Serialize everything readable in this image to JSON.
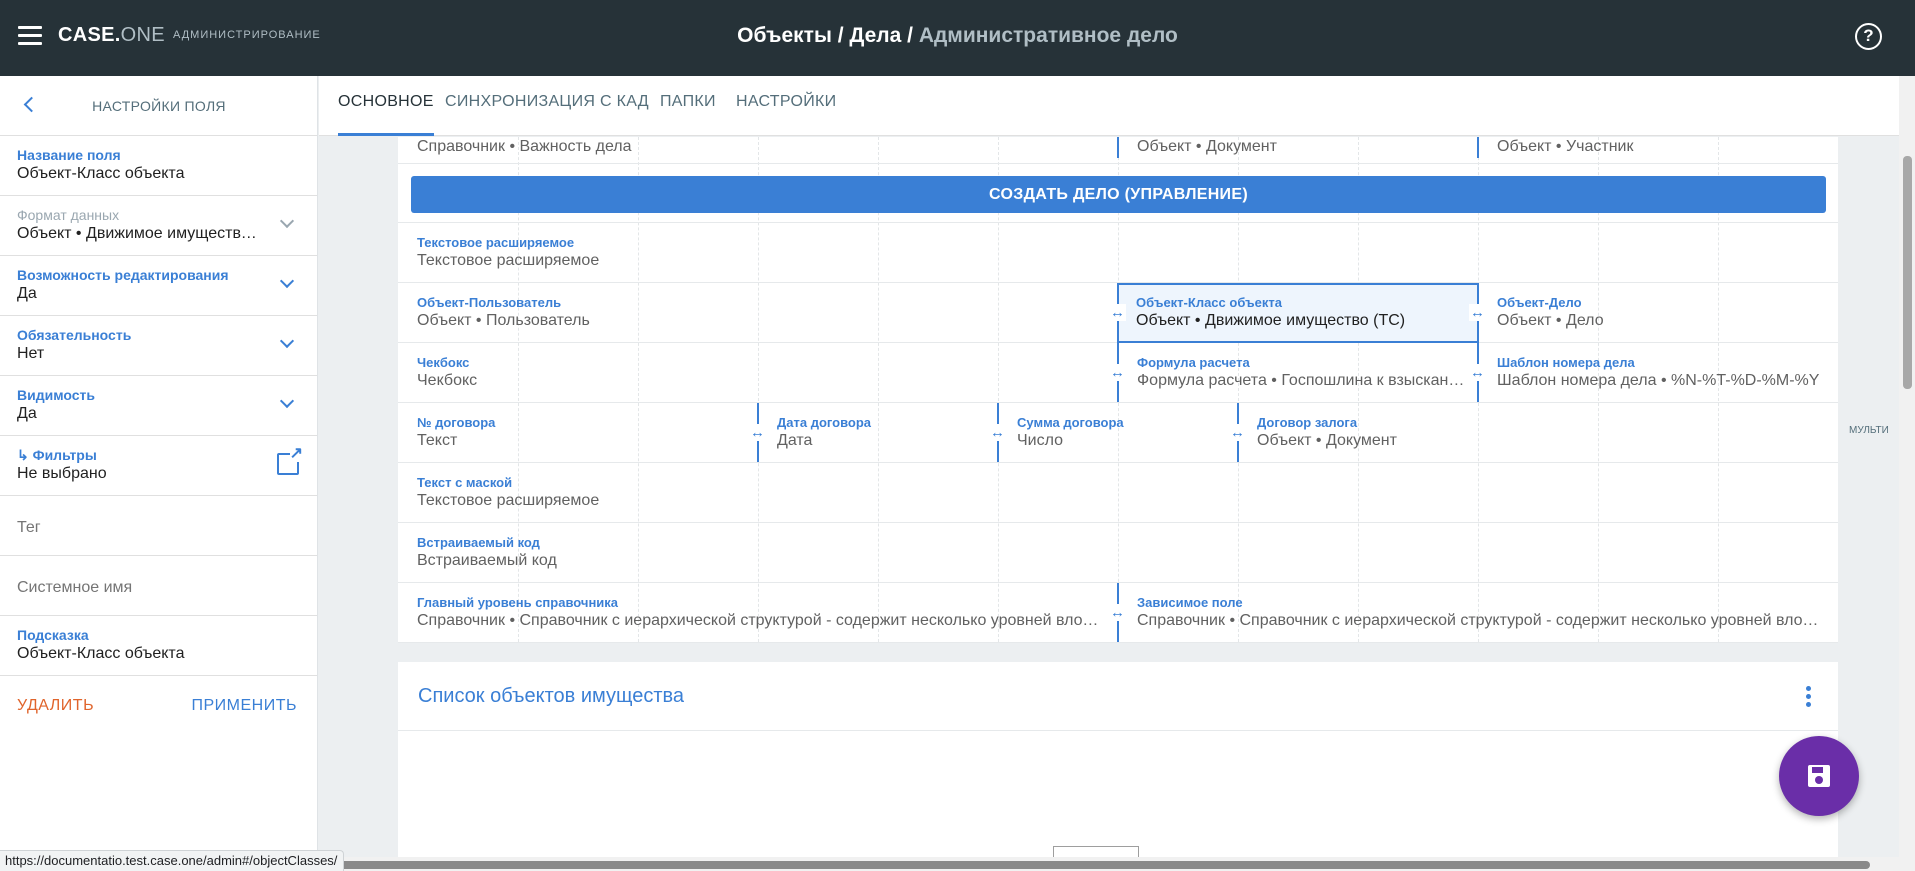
{
  "topbar": {
    "brand_main": "CASE.",
    "brand_accent": "ONE",
    "brand_sub": "АДМИНИСТРИРОВАНИЕ",
    "crumb_path": "Объекты / Дела / ",
    "crumb_current": "Административное дело",
    "help_symbol": "?"
  },
  "sidebar": {
    "title": "НАСТРОЙКИ ПОЛЯ",
    "fields": [
      {
        "label": "Название поля",
        "value": "Объект-Класс объекта"
      },
      {
        "label": "Формат данных",
        "value": "Объект • Движимое имущество (ТС)"
      },
      {
        "label": "Возможность редактирования",
        "value": "Да"
      },
      {
        "label": "Обязательность",
        "value": "Нет"
      },
      {
        "label": "Видимость",
        "value": "Да"
      },
      {
        "label": "Фильтры",
        "value": "Не выбрано"
      },
      {
        "placeholder": "Тег"
      },
      {
        "placeholder": "Системное имя"
      },
      {
        "label": "Подсказка",
        "value": "Объект-Класс объекта"
      }
    ],
    "delete_label": "УДАЛИТЬ",
    "apply_label": "ПРИМЕНИТЬ"
  },
  "tabs": [
    {
      "label": "ОСНОВНОЕ",
      "active": true
    },
    {
      "label": "СИНХРОНИЗАЦИЯ С КАД"
    },
    {
      "label": "ПАПКИ"
    },
    {
      "label": "НАСТРОЙКИ"
    }
  ],
  "layout_grid": {
    "row_top": [
      {
        "value": "Справочник • Важность дела"
      },
      {
        "value": "Объект • Документ"
      },
      {
        "value": "Объект • Участник"
      }
    ],
    "create_button": "СОЗДАТЬ ДЕЛО (УПРАВЛЕНИЕ)",
    "row_text_ext": {
      "label": "Текстовое расширяемое",
      "value": "Текстовое расширяемое"
    },
    "row_user": [
      {
        "label": "Объект-Пользователь",
        "value": "Объект • Пользователь"
      },
      {
        "label": "Объект-Класс объекта",
        "value": "Объект • Движимое имущество (ТС)"
      },
      {
        "label": "Объект-Дело",
        "value": "Объект • Дело"
      }
    ],
    "row_checkbox": [
      {
        "label": "Чекбокс",
        "value": "Чекбокс"
      },
      {
        "label": "Формула расчета",
        "value": "Формула расчета • Госпошлина к взысканию"
      },
      {
        "label": "Шаблон номера дела",
        "value": "Шаблон номера дела • %N-%T-%D-%M-%Y"
      }
    ],
    "row_contract": [
      {
        "label": "№ договора",
        "value": "Текст"
      },
      {
        "label": "Дата договора",
        "value": "Дата"
      },
      {
        "label": "Сумма договора",
        "value": "Число"
      },
      {
        "label": "Договор залога",
        "value": "Объект • Документ"
      }
    ],
    "row_mask": {
      "label": "Текст с маской",
      "value": "Текстовое расширяемое"
    },
    "row_embed": {
      "label": "Встраиваемый код",
      "value": "Встраиваемый код"
    },
    "row_hier": [
      {
        "label": "Главный уровень справочника",
        "value": "Справочник • Справочник с иерархической структурой - содержит несколько уровней вложенности"
      },
      {
        "label": "Зависимое поле",
        "value": "Справочник • Справочник с иерархической структурой - содержит несколько уровней вложенности"
      }
    ],
    "side_label": "МУЛЬТИ"
  },
  "list_section": {
    "title": "Список объектов имущества"
  },
  "status_url": "https://documentatio.test.case.one/admin#/objectClasses/",
  "colors": {
    "topbar": "#263238",
    "accent": "#3a7fd5",
    "delete": "#e0642b",
    "fab": "#6a2ea8"
  },
  "icons": [
    "menu-icon",
    "help-icon",
    "back-icon",
    "chevron-down-icon",
    "open-external-icon",
    "resize-handle-icon",
    "more-vert-icon",
    "save-icon"
  ]
}
